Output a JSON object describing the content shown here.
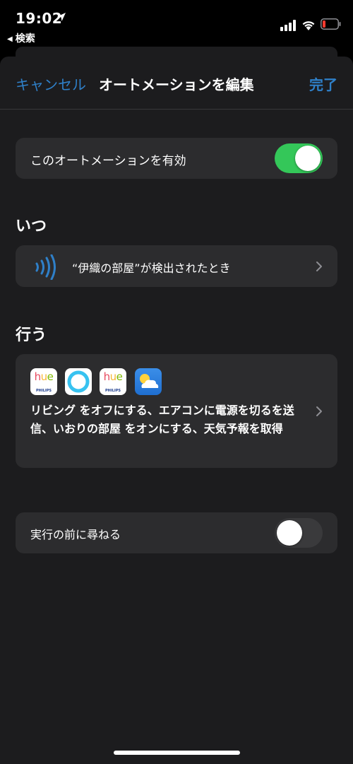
{
  "status_bar": {
    "time": "19:02",
    "back_app": "検索"
  },
  "nav": {
    "cancel": "キャンセル",
    "title": "オートメーションを編集",
    "done": "完了"
  },
  "enable_row": {
    "label": "このオートメーションを有効",
    "on": true
  },
  "when_section": {
    "header": "いつ",
    "trigger": "“伊織の部屋”が検出されたとき"
  },
  "do_section": {
    "header": "行う",
    "icons": [
      "hue-icon",
      "alexa-icon",
      "hue-icon",
      "weather-icon"
    ],
    "hue_label": "hue",
    "philips_label": "PHILIPS",
    "actions": "リビング をオフにする、エアコンに電源を切るを送信、いおりの部屋 をオンにする、天気予報を取得"
  },
  "ask_row": {
    "label": "実行の前に尋ねる",
    "on": false
  },
  "colors": {
    "accent": "#2f80c9",
    "toggle_on": "#34c759",
    "background": "#1c1c1e",
    "card": "#2c2c2e"
  }
}
